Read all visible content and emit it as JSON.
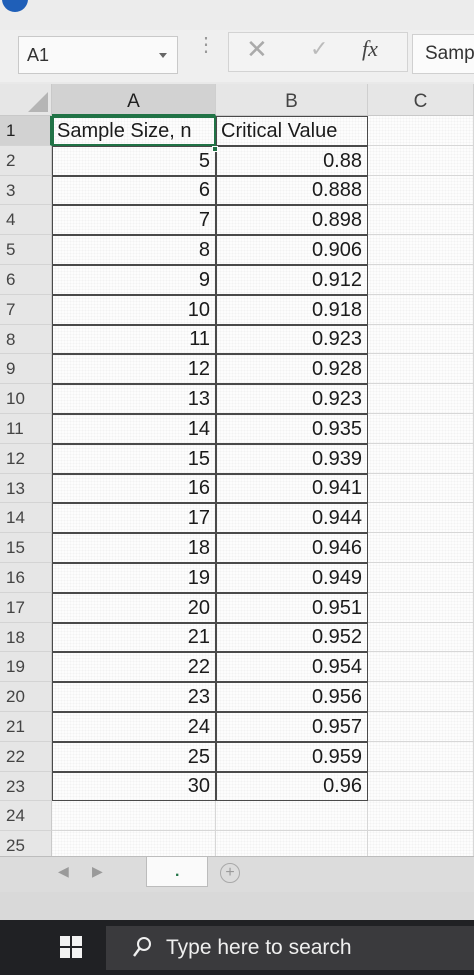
{
  "name_box": {
    "value": "A1"
  },
  "formula_bar": {
    "cancel_icon": "close-icon",
    "enter_icon": "check-icon",
    "fx_label": "fx",
    "content": "Samp"
  },
  "columns": [
    "A",
    "B",
    "C"
  ],
  "rows": [
    {
      "row": "1",
      "a": "Sample Size, n",
      "b": "Critical Value"
    },
    {
      "row": "2",
      "a": "5",
      "b": "0.88"
    },
    {
      "row": "3",
      "a": "6",
      "b": "0.888"
    },
    {
      "row": "4",
      "a": "7",
      "b": "0.898"
    },
    {
      "row": "5",
      "a": "8",
      "b": "0.906"
    },
    {
      "row": "6",
      "a": "9",
      "b": "0.912"
    },
    {
      "row": "7",
      "a": "10",
      "b": "0.918"
    },
    {
      "row": "8",
      "a": "11",
      "b": "0.923"
    },
    {
      "row": "9",
      "a": "12",
      "b": "0.928"
    },
    {
      "row": "10",
      "a": "13",
      "b": "0.923"
    },
    {
      "row": "11",
      "a": "14",
      "b": "0.935"
    },
    {
      "row": "12",
      "a": "15",
      "b": "0.939"
    },
    {
      "row": "13",
      "a": "16",
      "b": "0.941"
    },
    {
      "row": "14",
      "a": "17",
      "b": "0.944"
    },
    {
      "row": "15",
      "a": "18",
      "b": "0.946"
    },
    {
      "row": "16",
      "a": "19",
      "b": "0.949"
    },
    {
      "row": "17",
      "a": "20",
      "b": "0.951"
    },
    {
      "row": "18",
      "a": "21",
      "b": "0.952"
    },
    {
      "row": "19",
      "a": "22",
      "b": "0.954"
    },
    {
      "row": "20",
      "a": "23",
      "b": "0.956"
    },
    {
      "row": "21",
      "a": "24",
      "b": "0.957"
    },
    {
      "row": "22",
      "a": "25",
      "b": "0.959"
    },
    {
      "row": "23",
      "a": "30",
      "b": "0.96"
    },
    {
      "row": "24",
      "a": "",
      "b": ""
    },
    {
      "row": "25",
      "a": "",
      "b": ""
    }
  ],
  "sheet_tabs": {
    "label": "."
  },
  "taskbar": {
    "search_placeholder": "Type here to search",
    "start_icon": "windows-logo-icon",
    "search_icon": "search-icon"
  },
  "colors": {
    "excel_green": "#217346",
    "taskbar": "#202124"
  }
}
